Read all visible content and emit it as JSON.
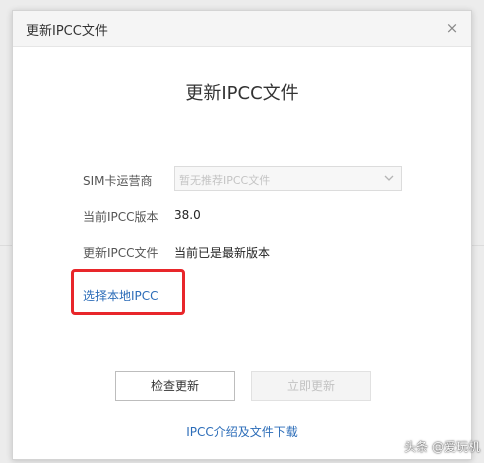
{
  "window": {
    "title": "更新IPCC文件",
    "close_glyph": "×"
  },
  "main": {
    "heading": "更新IPCC文件",
    "carrier_label": "SIM卡运营商",
    "carrier_select_value": "暂无推荐IPCC文件",
    "current_version_label": "当前IPCC版本",
    "current_version_value": "38.0",
    "update_file_label": "更新IPCC文件",
    "update_file_value": "当前已是最新版本",
    "choose_local_link": "选择本地IPCC"
  },
  "buttons": {
    "check_update": "检查更新",
    "update_now": "立即更新"
  },
  "footer": {
    "intro_link": "IPCC介绍及文件下载"
  },
  "watermark": {
    "text": "头条 @爱玩机"
  },
  "colors": {
    "link": "#2b6cb8",
    "highlight": "#e8262a",
    "disabled_text": "#c2c2c2"
  },
  "icons": {
    "close": "close-icon",
    "dropdown": "chevron-down-icon",
    "watermark_logo": "watermark-logo-icon"
  }
}
